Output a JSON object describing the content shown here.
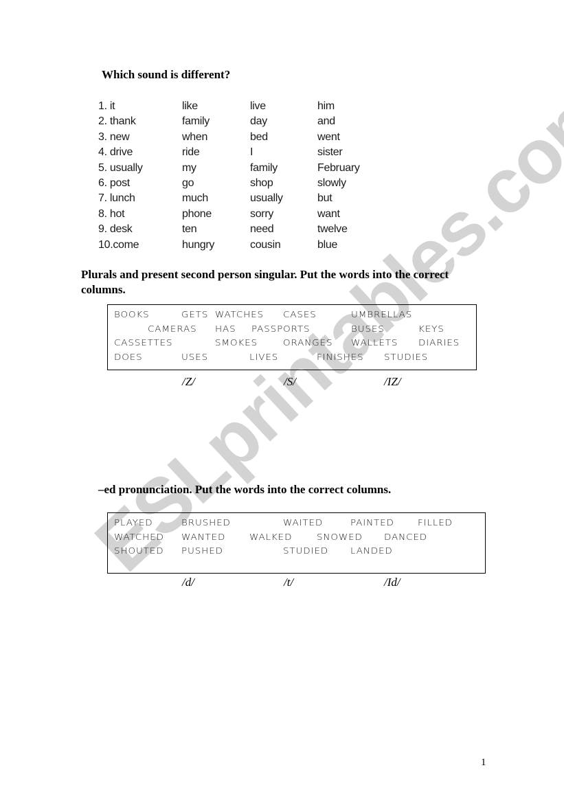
{
  "watermark": "ESLprintables.com",
  "section1": {
    "title": "Which sound is different?",
    "rows": [
      [
        "1. it",
        "like",
        "live",
        "him"
      ],
      [
        "2. thank",
        "family",
        "day",
        "and"
      ],
      [
        "3. new",
        "when",
        "bed",
        "went"
      ],
      [
        "4. drive",
        "ride",
        "I",
        "sister"
      ],
      [
        "5. usually",
        "my",
        "family",
        "February"
      ],
      [
        "6. post",
        "go",
        "shop",
        "slowly"
      ],
      [
        "7. lunch",
        "much",
        "usually",
        "but"
      ],
      [
        "8. hot",
        "phone",
        "sorry",
        "want"
      ],
      [
        "9. desk",
        "ten",
        "need",
        "twelve"
      ],
      [
        "10.come",
        "hungry",
        "cousin",
        "blue"
      ]
    ]
  },
  "section2": {
    "title": "Plurals and present second person singular. Put the words into the correct columns.",
    "words": [
      [
        "BOOKS",
        "GETS",
        "WATCHES",
        "CASES",
        "UMBRELLAS"
      ],
      [
        "CAMERAS",
        "HAS",
        "PASSPORTS",
        "BUSES",
        "KEYS"
      ],
      [
        "CASSETTES",
        "SMOKES",
        "ORANGES",
        "WALLETS",
        "DIARIES"
      ],
      [
        "DOES",
        "USES",
        "LIVES",
        "FINISHES",
        "STUDIES"
      ]
    ],
    "columns": [
      "/Z/",
      "/S/",
      "/IZ/"
    ]
  },
  "section3": {
    "title": "–ed pronunciation. Put the words into the correct columns.",
    "words": [
      [
        "PLAYED",
        "BRUSHED",
        "WAITED",
        "PAINTED",
        "FILLED"
      ],
      [
        "WATCHED",
        "WANTED",
        "WALKED",
        "SNOWED",
        "DANCED"
      ],
      [
        "SHOUTED",
        "PUSHED",
        "STUDIED",
        "LANDED"
      ]
    ],
    "columns": [
      "/d/",
      "/t/",
      "/Id/"
    ]
  },
  "footer": {
    "page_number": "1"
  }
}
